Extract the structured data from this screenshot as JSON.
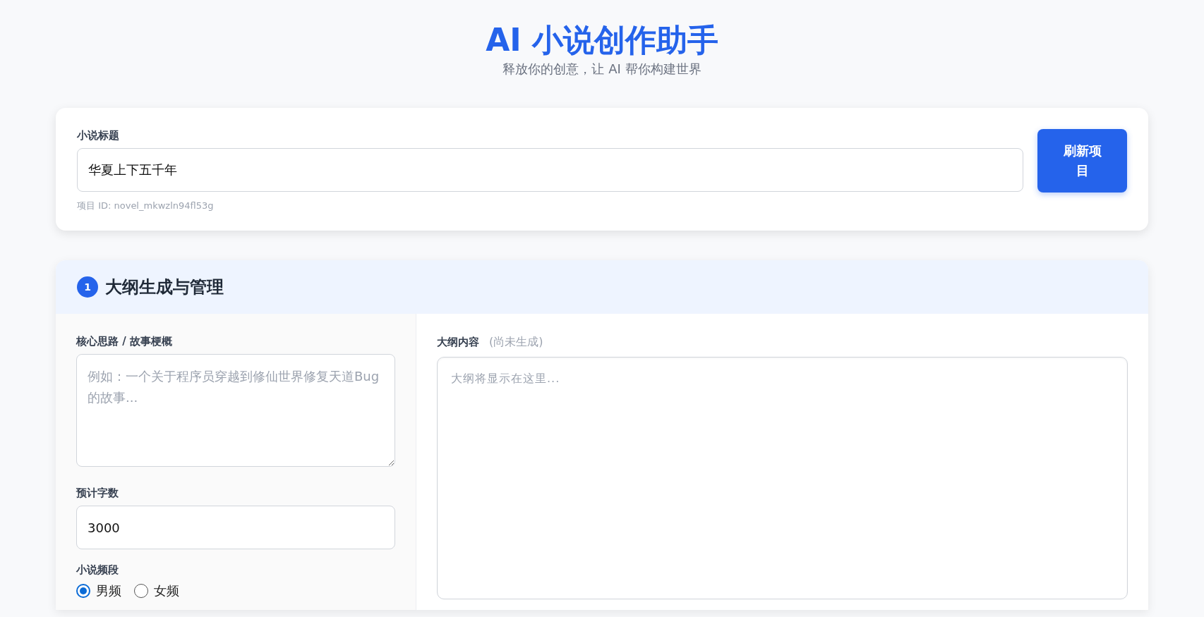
{
  "header": {
    "title": "AI 小说创作助手",
    "subtitle": "释放你的创意，让 AI 帮你构建世界"
  },
  "project": {
    "title_label": "小说标题",
    "title_value": "华夏上下五千年",
    "project_id": "项目 ID: novel_mkwzln94fl53g",
    "refresh_button": "刷新项目"
  },
  "outline_section": {
    "step": "1",
    "title": "大纲生成与管理",
    "idea": {
      "label": "核心思路 / 故事梗概",
      "placeholder": "例如：一个关于程序员穿越到修仙世界修复天道Bug的故事..."
    },
    "word_count": {
      "label": "预计字数",
      "value": "3000"
    },
    "genre": {
      "label": "小说频段",
      "options": [
        {
          "label": "男频",
          "selected": true
        },
        {
          "label": "女频",
          "selected": false
        }
      ]
    },
    "outline": {
      "label": "大纲内容",
      "status": "(尚未生成)",
      "placeholder": "大纲将显示在这里..."
    }
  }
}
